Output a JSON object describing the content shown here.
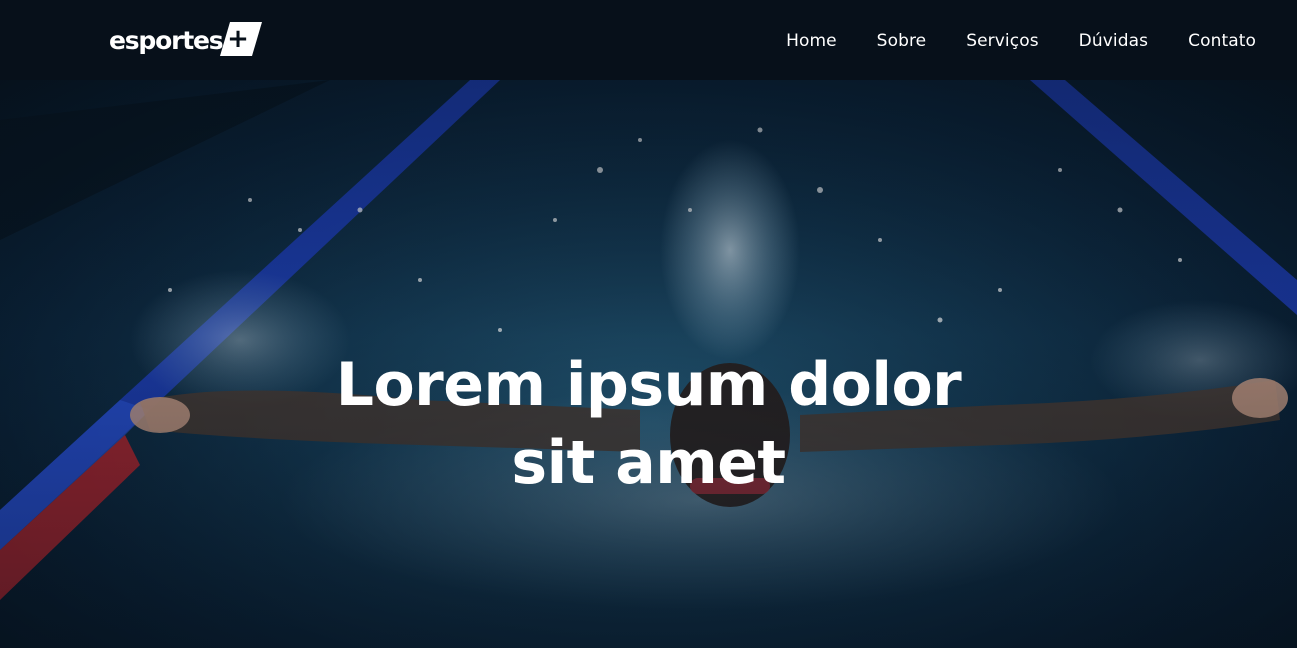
{
  "brand": {
    "name": "esportes",
    "badge_symbol": "+"
  },
  "nav": {
    "items": [
      {
        "label": "Home"
      },
      {
        "label": "Sobre"
      },
      {
        "label": "Serviços"
      },
      {
        "label": "Dúvidas"
      },
      {
        "label": "Contato"
      }
    ]
  },
  "hero": {
    "title_line1": "Lorem ipsum dolor",
    "title_line2": "sit amet",
    "image_subject": "swimmer-butterfly-stroke-photo"
  },
  "colors": {
    "navbar_bg": "#07101a",
    "text": "#ffffff",
    "water": "#123650",
    "lane_blue": "#1f3fbf",
    "lane_red": "#b3262f"
  }
}
